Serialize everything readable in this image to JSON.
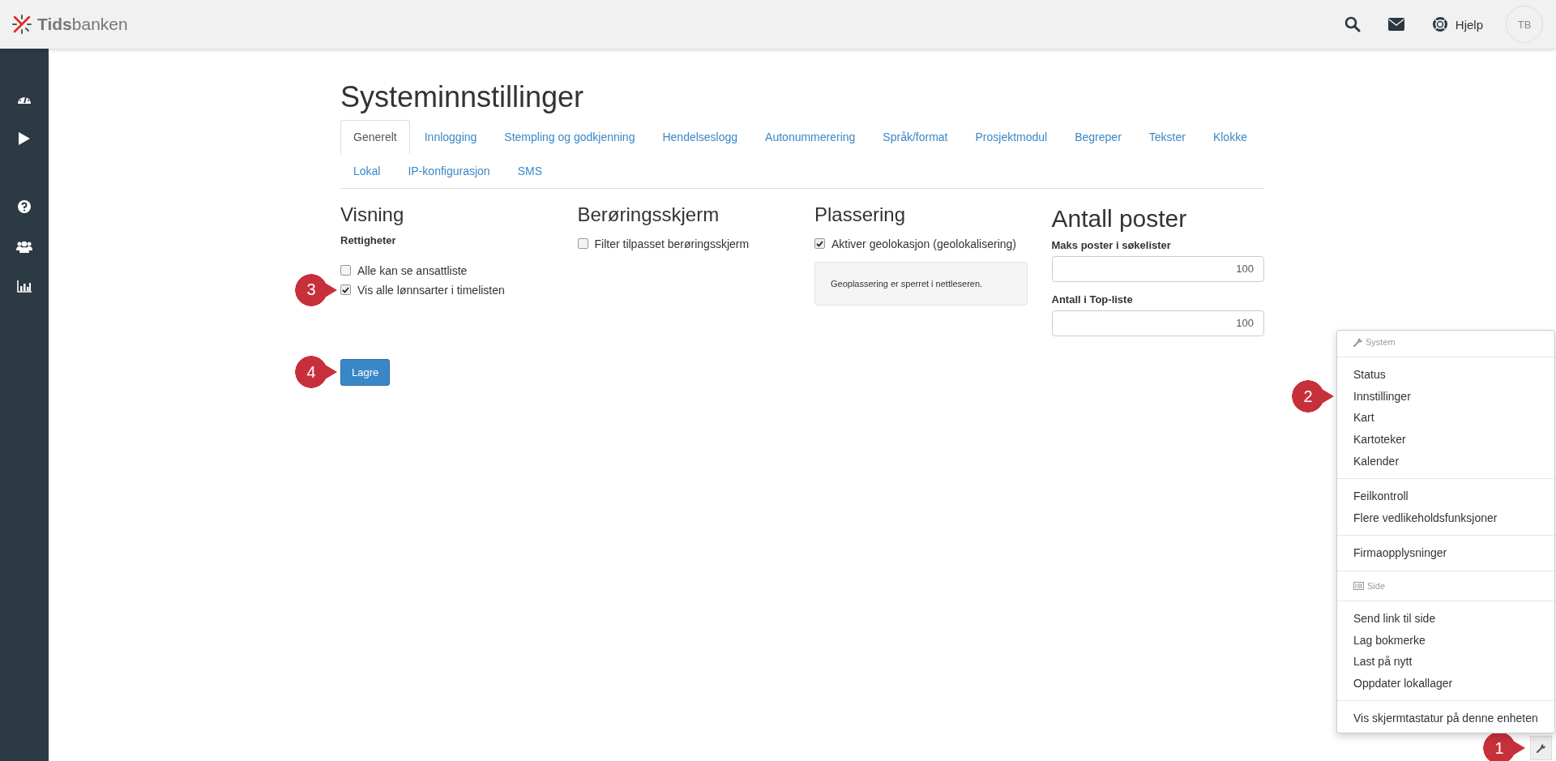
{
  "topbar": {
    "logo": "**Tids**banken",
    "help": "Hjelp",
    "avatar": "TB"
  },
  "page": {
    "title": "Systeminnstillinger",
    "tabs": [
      {
        "label": "Generelt",
        "selected": true
      },
      {
        "label": "Innlogging",
        "selected": false
      },
      {
        "label": "Stempling og godkjenning",
        "selected": false
      },
      {
        "label": "Hendelseslogg",
        "selected": false
      },
      {
        "label": "Autonummerering",
        "selected": false
      },
      {
        "label": "Språk/format",
        "selected": false
      },
      {
        "label": "Prosjektmodul",
        "selected": false
      },
      {
        "label": "Begreper",
        "selected": false
      },
      {
        "label": "Tekster",
        "selected": false
      },
      {
        "label": "Klokke",
        "selected": false
      },
      {
        "label": "Lokal",
        "selected": false
      },
      {
        "label": "IP-konfigurasjon",
        "selected": false
      },
      {
        "label": "SMS",
        "selected": false
      }
    ],
    "sections": [
      {
        "kind": "checks",
        "heading": "Visning",
        "subheading": "Rettigheter",
        "options": [
          {
            "label": "Alle kan se ansattliste",
            "checked": false
          },
          {
            "label": "Vis alle lønnsarter i timelisten",
            "checked": true,
            "callout": "3"
          }
        ]
      },
      {
        "kind": "checks",
        "heading": "Berøringsskjerm",
        "options": [
          {
            "label": "Filter tilpasset berøringsskjerm",
            "checked": false
          }
        ]
      },
      {
        "kind": "checks",
        "heading": "Plassering",
        "options": [
          {
            "label": "Aktiver geolokasjon (geolokalisering)",
            "checked": true
          }
        ],
        "note": "Geoplassering er sperret i nettleseren."
      },
      {
        "kind": "fields",
        "heading": "Antall poster",
        "fields": [
          {
            "label": "Maks poster i søkelister",
            "value": "100"
          },
          {
            "label": "Antall i Top-liste",
            "value": "100"
          }
        ]
      }
    ],
    "save": {
      "label": "Lagre",
      "callout": "4"
    }
  },
  "menu": {
    "groups": [
      {
        "kind": "header",
        "label": "System"
      },
      {
        "kind": "items",
        "items": [
          {
            "label": "Status"
          },
          {
            "label": "Innstillinger",
            "callout": "2"
          },
          {
            "label": "Kart"
          },
          {
            "label": "Kartoteker"
          },
          {
            "label": "Kalender"
          }
        ]
      },
      {
        "kind": "items",
        "items": [
          {
            "label": "Feilkontroll"
          },
          {
            "label": "Flere vedlikeholdsfunksjoner"
          }
        ]
      },
      {
        "kind": "items",
        "items": [
          {
            "label": "Firmaopplysninger"
          }
        ]
      },
      {
        "kind": "header",
        "label": "Side"
      },
      {
        "kind": "items",
        "items": [
          {
            "label": "Send link til side"
          },
          {
            "label": "Lag bokmerke"
          },
          {
            "label": "Last på nytt"
          },
          {
            "label": "Oppdater lokallager"
          }
        ]
      },
      {
        "kind": "items",
        "items": [
          {
            "label": "Vis skjermtastatur på denne enheten"
          }
        ]
      }
    ],
    "toggle": {
      "callout": "1"
    }
  }
}
